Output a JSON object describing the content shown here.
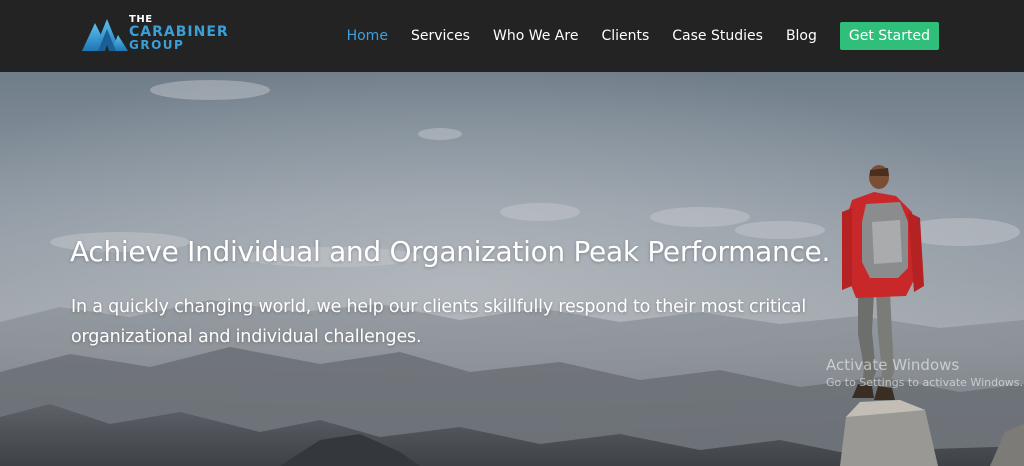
{
  "logo": {
    "line1": "THE",
    "line2": "CARABINER",
    "line3": "GROUP"
  },
  "nav": {
    "items": [
      {
        "label": "Home",
        "active": true
      },
      {
        "label": "Services",
        "active": false
      },
      {
        "label": "Who We Are",
        "active": false
      },
      {
        "label": "Clients",
        "active": false
      },
      {
        "label": "Case Studies",
        "active": false
      },
      {
        "label": "Blog",
        "active": false
      }
    ],
    "cta_label": "Get Started"
  },
  "hero": {
    "title": "Achieve Individual and Organization Peak Performance.",
    "subtitle_line1": "In a quickly changing world, we help our clients skillfully respond to their most critical",
    "subtitle_line2": "organizational and individual challenges."
  },
  "watermark": {
    "title": "Activate Windows",
    "subtitle": "Go to Settings to activate Windows."
  },
  "colors": {
    "header_bg": "#232323",
    "nav_active": "#3f9fe0",
    "cta_bg": "#2fbf7a",
    "logo_blue": "#3aa0d6"
  },
  "icons": {
    "logo_mark": "mountain-peaks-icon"
  }
}
